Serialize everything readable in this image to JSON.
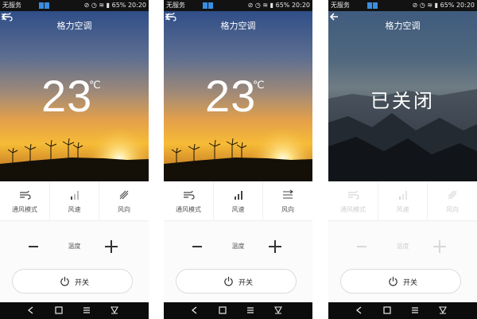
{
  "statusbar": {
    "carrier": "无服务",
    "battery": "65%",
    "time": "20:20"
  },
  "screens": [
    {
      "title": "格力空调",
      "temperature": "23",
      "unit": "℃",
      "modes": [
        "通风模式",
        "风速",
        "风向"
      ],
      "temp_label": "温度",
      "power_label": "开关"
    },
    {
      "title": "格力空调",
      "temperature": "23",
      "unit": "℃",
      "modes": [
        "通风模式",
        "风速",
        "风向"
      ],
      "temp_label": "温度",
      "power_label": "开关"
    },
    {
      "title": "格力空调",
      "status": "已关闭",
      "modes": [
        "通风模式",
        "风速",
        "风向"
      ],
      "temp_label": "温度",
      "power_label": "开关"
    }
  ],
  "icons": {
    "back": "back-arrow-icon",
    "fan": "fan-wind-icon",
    "speed": "signal-bars-icon",
    "direction": "wind-direction-icon",
    "power": "power-icon",
    "nav": [
      "nav-back-icon",
      "nav-home-icon",
      "nav-menu-icon",
      "nav-notification-icon"
    ]
  },
  "colors": {
    "accent_sunset": "#f6bb36",
    "sky_top": "#2f4e88",
    "off_sky": "#3f5b7e"
  }
}
